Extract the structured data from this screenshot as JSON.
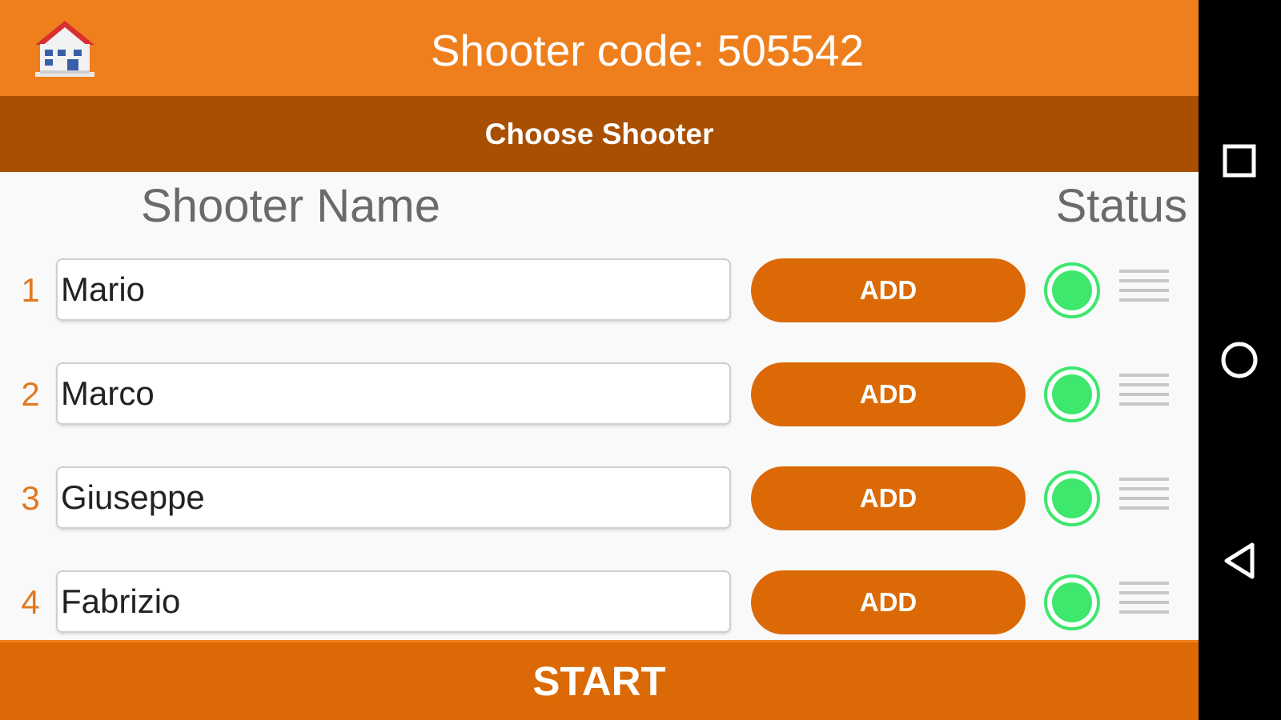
{
  "header": {
    "title": "Shooter code: 505542",
    "home_icon": "house-icon",
    "background": "#ef7f1d"
  },
  "subheader": {
    "title": "Choose Shooter",
    "background": "#a84f02"
  },
  "columns": {
    "name": "Shooter Name",
    "status": "Status"
  },
  "shooters": [
    {
      "number": "1",
      "name": "Mario",
      "button": "ADD",
      "status": "active"
    },
    {
      "number": "2",
      "name": "Marco",
      "button": "ADD",
      "status": "active"
    },
    {
      "number": "3",
      "name": "Giuseppe",
      "button": "ADD",
      "status": "active"
    },
    {
      "number": "4",
      "name": "Fabrizio",
      "button": "ADD",
      "status": "active"
    }
  ],
  "start_button": "START",
  "colors": {
    "accent": "#db6905",
    "status_active": "#3ee86d"
  },
  "system_nav": {
    "recents_icon": "square-icon",
    "home_icon": "circle-icon",
    "back_icon": "triangle-back-icon"
  }
}
